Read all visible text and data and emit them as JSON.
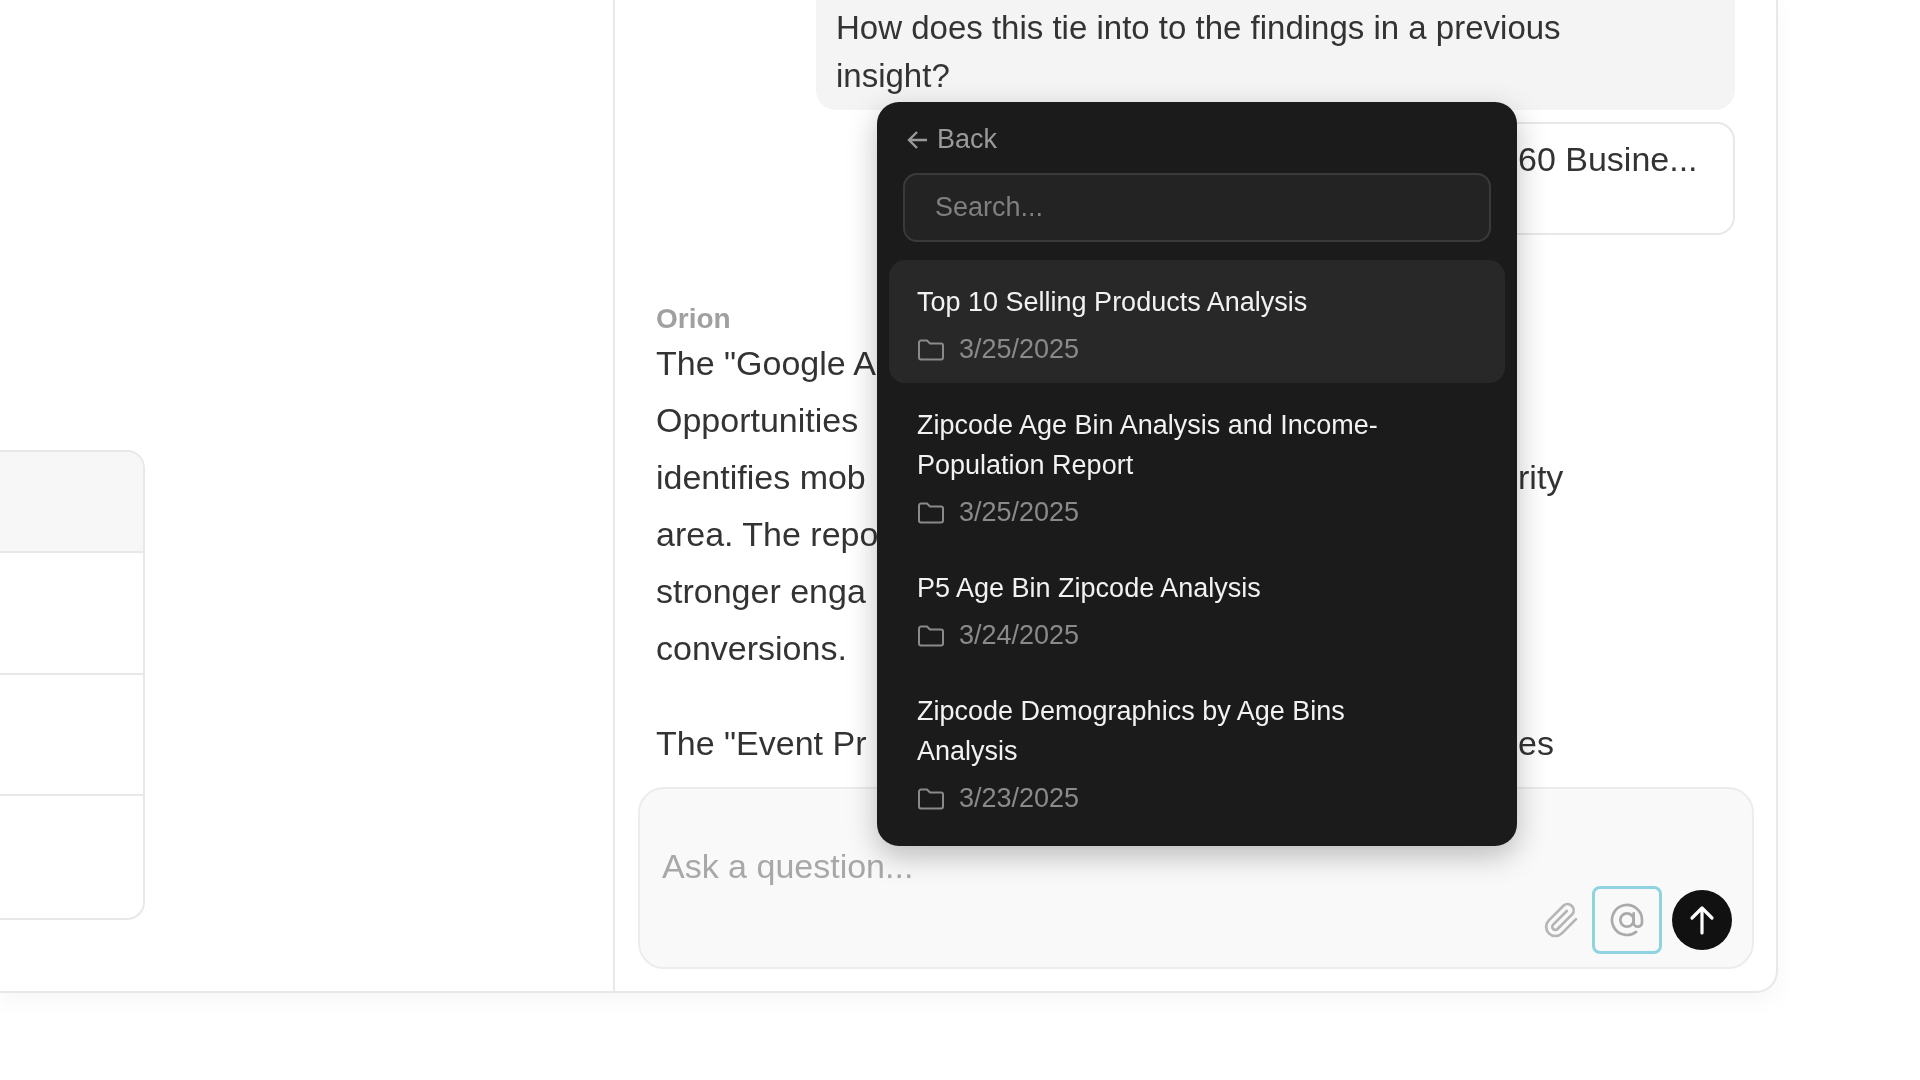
{
  "user_message": {
    "text": "How does this tie into to the findings in a previous insight?"
  },
  "attachment_chip": {
    "label": "60 Busine..."
  },
  "assistant_message": {
    "author": "Orion",
    "paragraphs": [
      {
        "lines": [
          {
            "start": "The \"Google A"
          },
          {
            "start": "Opportunities"
          },
          {
            "start": "identifies mob",
            "end": "rity"
          },
          {
            "start": "area. The repo"
          },
          {
            "start": "stronger enga"
          },
          {
            "start": "conversions."
          }
        ]
      },
      {
        "lines": [
          {
            "start": "The \"Event Pr",
            "end": "es"
          }
        ]
      }
    ]
  },
  "mention_menu": {
    "back_label": "Back",
    "search": {
      "placeholder": "Search..."
    },
    "items": [
      {
        "title": "Top 10 Selling Products Analysis",
        "date": "3/25/2025",
        "selected": true
      },
      {
        "title": "Zipcode Age Bin Analysis and Income-Population Report",
        "date": "3/25/2025",
        "selected": false
      },
      {
        "title": "P5 Age Bin Zipcode Analysis",
        "date": "3/24/2025",
        "selected": false
      },
      {
        "title": "Zipcode Demographics by Age Bins Analysis",
        "date": "3/23/2025",
        "selected": false
      }
    ]
  },
  "composer": {
    "placeholder": "Ask a question...",
    "mention_active": true
  }
}
